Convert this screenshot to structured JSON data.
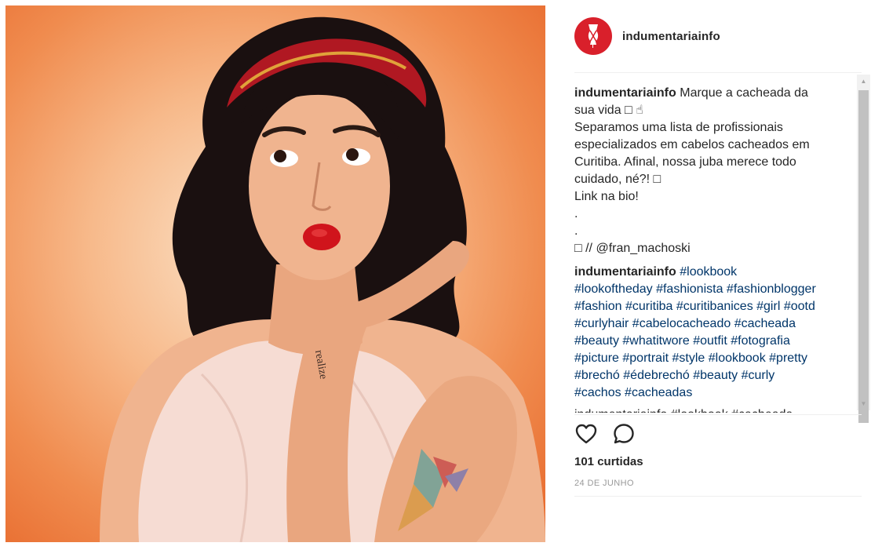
{
  "post": {
    "username": "indumentariainfo",
    "caption_user": "indumentariainfo",
    "caption_lines": [
      "Marque a cacheada da",
      "sua vida □ ☝",
      "Separamos uma lista de profissionais",
      "especializados em cabelos cacheados em",
      "Curitiba. Afinal, nossa juba merece todo",
      "cuidado, né?! □",
      "Link na bio!",
      ".",
      ".",
      "□ // @fran_machoski"
    ],
    "comment_user": "indumentariainfo",
    "hashtag_lines": [
      "#lookbook",
      "#lookoftheday #fashionista #fashionblogger",
      "#fashion #curitiba #curitibanices #girl #ootd",
      "#curlyhair #cabelocacheado #cacheada",
      "#beauty #whatitwore #outfit #fotografia",
      "#picture #portrait #style #lookbook #pretty",
      "#brechó #édebrechó #beauty #curly",
      "#cachos #cacheadas"
    ],
    "cut_line": "indumentariainfo #lookbook #cacheada",
    "likes": "101 curtidas",
    "date": "24 DE JUNHO",
    "tattoo_text": "realize"
  },
  "icons": {
    "like": "heart-icon",
    "comment": "comment-icon",
    "avatar": "dress-form-logo-icon"
  },
  "colors": {
    "brand_red": "#d9202b",
    "hashtag_blue": "#003569",
    "text": "#262626",
    "muted": "#999999",
    "lips": "#d0141c"
  }
}
